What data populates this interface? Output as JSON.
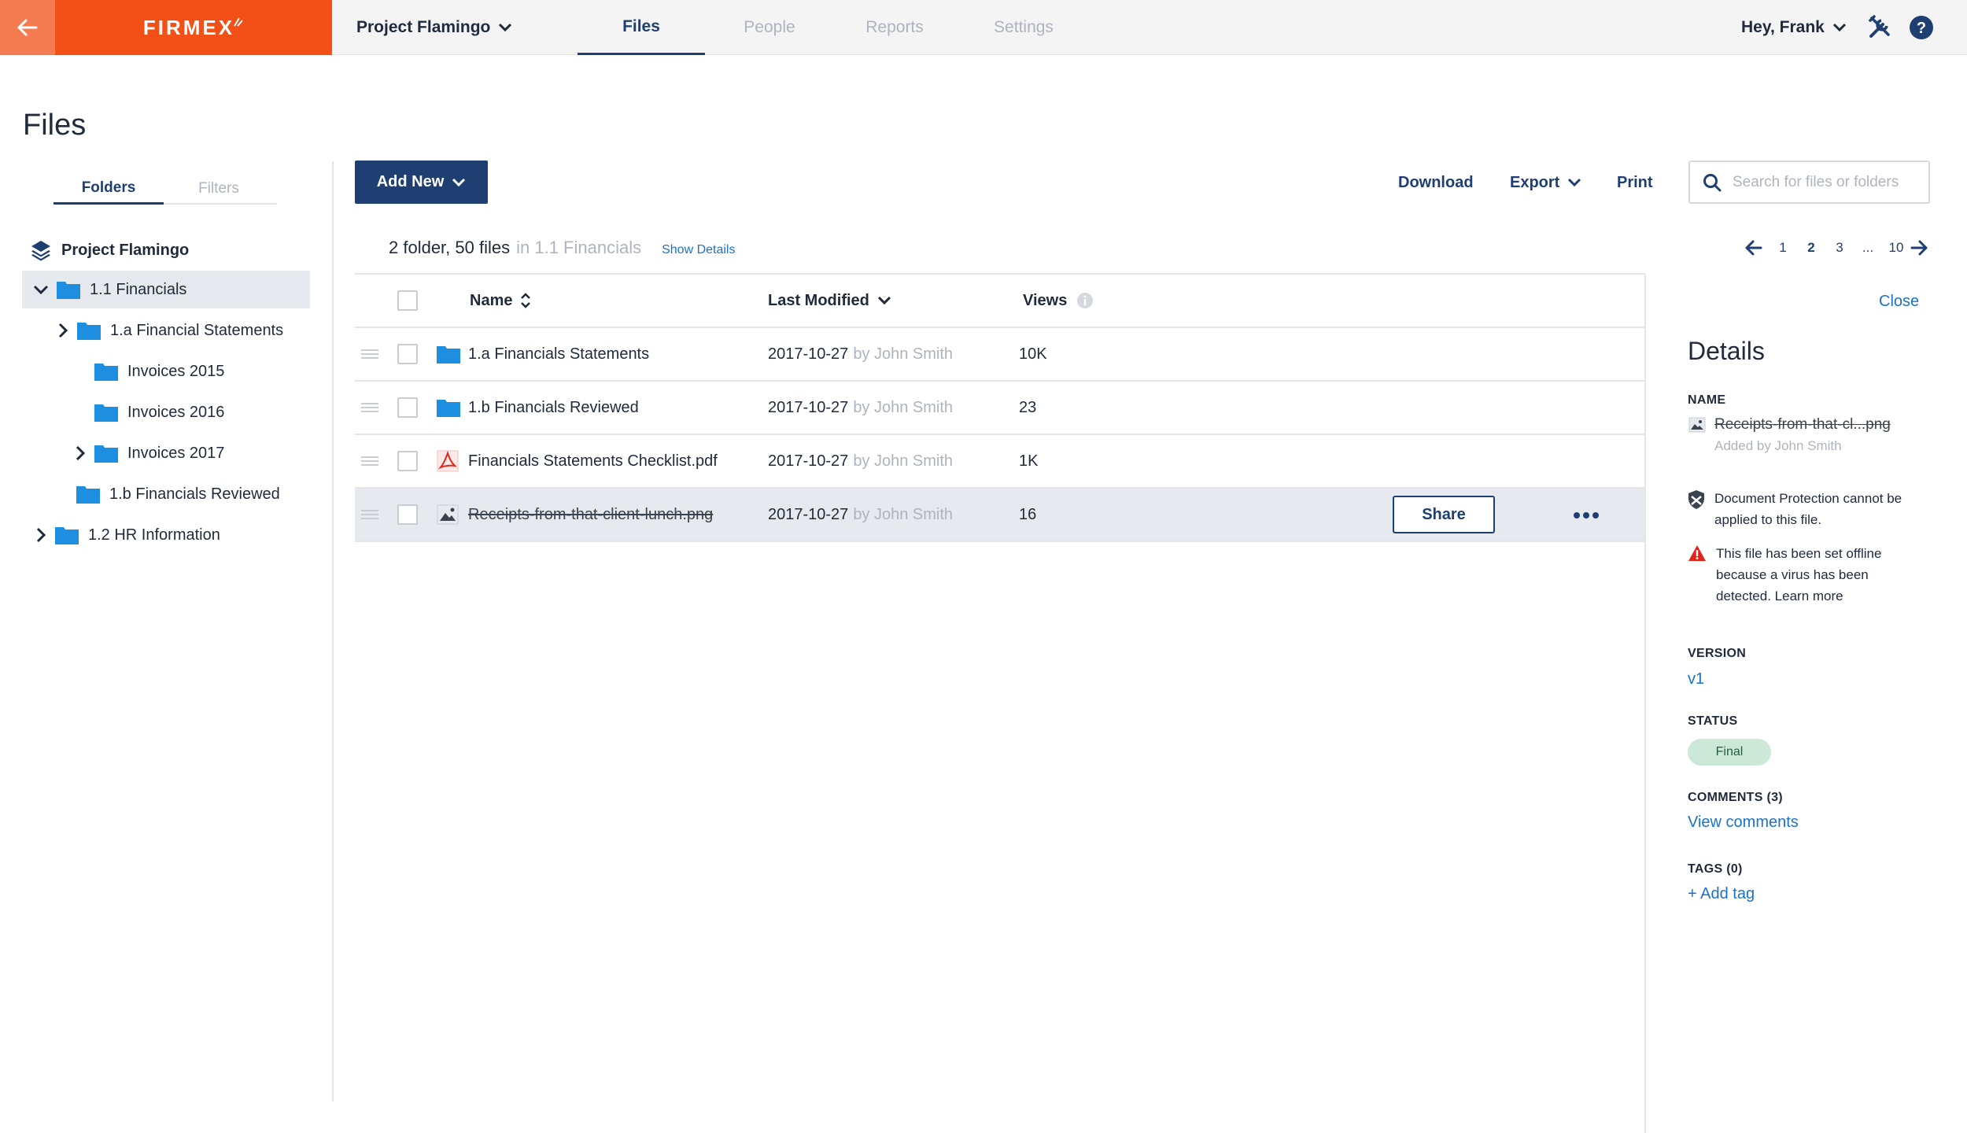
{
  "topbar": {
    "logo": "FIRMEX",
    "project": "Project Flamingo",
    "tabs": [
      {
        "label": "Files",
        "active": true
      },
      {
        "label": "People",
        "active": false
      },
      {
        "label": "Reports",
        "active": false
      },
      {
        "label": "Settings",
        "active": false
      }
    ],
    "greeting": "Hey, Frank",
    "brand_color": "#f25016",
    "accent_color": "#1f3f73"
  },
  "page": {
    "title": "Files"
  },
  "left_panel": {
    "tabs": [
      "Folders",
      "Filters"
    ],
    "root": "Project Flamingo",
    "tree": [
      {
        "label": "1.1 Financials",
        "expanded": true,
        "selected": true
      },
      {
        "label": "1.a Financial Statements",
        "expanded": false
      },
      {
        "label": "Invoices 2015"
      },
      {
        "label": "Invoices 2016"
      },
      {
        "label": "Invoices 2017",
        "expanded": false
      },
      {
        "label": "1.b Financials Reviewed"
      },
      {
        "label": "1.2 HR Information",
        "expanded": false
      }
    ]
  },
  "toolbar": {
    "add_new": "Add New",
    "download": "Download",
    "export": "Export",
    "print": "Print",
    "search_placeholder": "Search for files or folders"
  },
  "summary": {
    "count": "2 folder, 50 files",
    "location": "in 1.1 Financials",
    "show_details": "Show Details"
  },
  "pagination": {
    "pages": [
      "1",
      "2",
      "3",
      "...",
      "10"
    ],
    "current": "2"
  },
  "table": {
    "headers": {
      "name": "Name",
      "modified": "Last Modified",
      "views": "Views"
    },
    "rows": [
      {
        "type": "folder",
        "name": "1.a Financials Statements",
        "date": "2017-10-27",
        "by": "by John Smith",
        "views": "10K"
      },
      {
        "type": "folder",
        "name": "1.b Financials Reviewed",
        "date": "2017-10-27",
        "by": "by John Smith",
        "views": "23"
      },
      {
        "type": "pdf",
        "name": "Financials Statements Checklist.pdf",
        "date": "2017-10-27",
        "by": "by John Smith",
        "views": "1K"
      },
      {
        "type": "image",
        "name": "Receipts-from-that-client-lunch.png",
        "date": "2017-10-27",
        "by": "by John Smith",
        "views": "16",
        "selected": true,
        "struck": true
      }
    ],
    "share_label": "Share"
  },
  "details": {
    "close": "Close",
    "title": "Details",
    "name_label": "NAME",
    "file_name": "Receipts-from-that-cl...png",
    "added_by": "Added by John Smith",
    "protection_notice": "Document Protection cannot be applied to this file.",
    "virus_notice": "This file has been set offline because a virus has been detected. Learn more",
    "version_label": "VERSION",
    "version": "v1",
    "status_label": "STATUS",
    "status": "Final",
    "comments_label": "COMMENTS (3)",
    "view_comments": "View comments",
    "tags_label": "TAGS (0)",
    "add_tag": "+ Add tag",
    "warning_color": "#e0261b"
  }
}
